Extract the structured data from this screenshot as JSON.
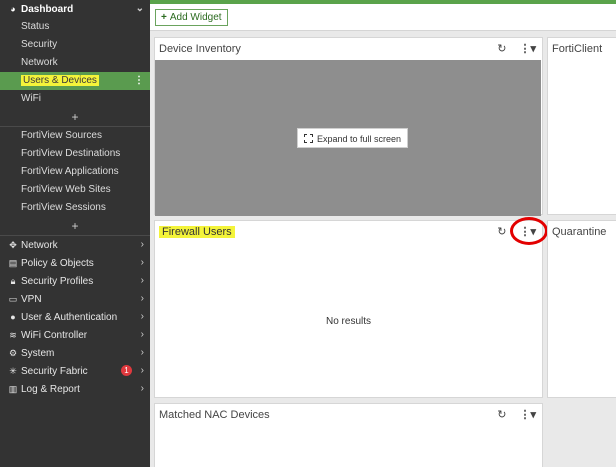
{
  "sidebar": {
    "dashboard": {
      "label": "Dashboard",
      "icon": "dashboard-icon",
      "items": [
        "Status",
        "Security",
        "Network",
        "Users & Devices",
        "WiFi"
      ]
    },
    "fortiview": [
      "FortiView Sources",
      "FortiView Destinations",
      "FortiView Applications",
      "FortiView Web Sites",
      "FortiView Sessions"
    ],
    "plus": "+",
    "main": [
      {
        "label": "Network",
        "icon": "network-icon"
      },
      {
        "label": "Policy & Objects",
        "icon": "policy-icon"
      },
      {
        "label": "Security Profiles",
        "icon": "lock-icon"
      },
      {
        "label": "VPN",
        "icon": "vpn-icon"
      },
      {
        "label": "User & Authentication",
        "icon": "user-icon"
      },
      {
        "label": "WiFi Controller",
        "icon": "wifi-icon"
      },
      {
        "label": "System",
        "icon": "gear-icon"
      },
      {
        "label": "Security Fabric",
        "icon": "fabric-icon",
        "badge": "1"
      },
      {
        "label": "Log & Report",
        "icon": "chart-icon"
      }
    ]
  },
  "toolbar": {
    "add_widget": "Add Widget",
    "plus": "+"
  },
  "widgets": {
    "device_inventory": {
      "title": "Device Inventory",
      "expand": "Expand to full screen"
    },
    "forticlient": {
      "title": "FortiClient"
    },
    "firewall_users": {
      "title": "Firewall Users",
      "empty": "No results"
    },
    "quarantine": {
      "title": "Quarantine"
    },
    "matched_nac": {
      "title": "Matched NAC Devices"
    }
  },
  "colors": {
    "sidebar_bg": "#333333",
    "active": "#5a9b4f",
    "highlight": "#f4f43a",
    "accent": "#5aa34b",
    "annotation": "#e30000"
  }
}
